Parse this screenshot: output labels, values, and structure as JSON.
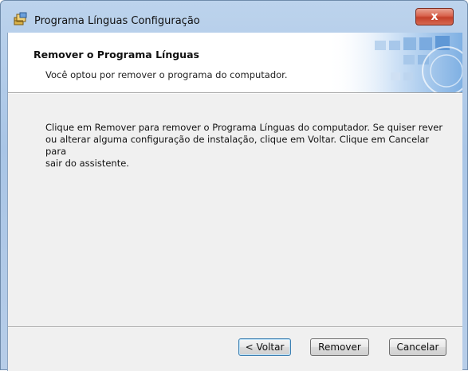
{
  "window": {
    "title": "Programa Línguas Configuração",
    "close_label": "x"
  },
  "banner": {
    "title": "Remover o Programa Línguas",
    "subtitle": "Você optou por remover o programa do computador."
  },
  "body": {
    "text": "Clique em Remover para remover o Programa Línguas do computador.  Se quiser rever\nou alterar alguma configuração de instalação, clique em Voltar.  Clique em Cancelar para\nsair do assistente."
  },
  "buttons": {
    "back_label": "< Voltar",
    "remove_label": "Remover",
    "cancel_label": "Cancelar"
  },
  "colors": {
    "titlebar": "#bcd3ec",
    "close": "#c4402a",
    "banner_art": "#3f7fc8"
  },
  "icons": {
    "app": "installer-package-icon",
    "close": "close-icon"
  }
}
